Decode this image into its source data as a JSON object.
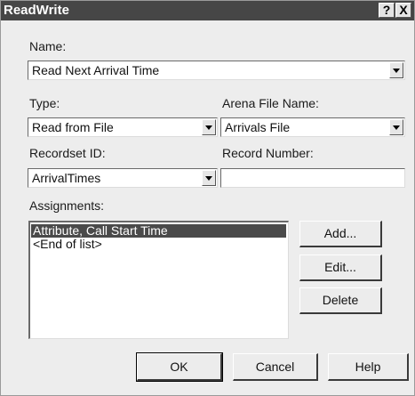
{
  "window": {
    "title": "ReadWrite",
    "help_glyph": "?",
    "close_glyph": "X"
  },
  "name": {
    "label": "Name:",
    "value": "Read Next Arrival Time"
  },
  "type": {
    "label": "Type:",
    "value": "Read from File"
  },
  "arena_file": {
    "label": "Arena File Name:",
    "value": "Arrivals File"
  },
  "recordset": {
    "label": "Recordset ID:",
    "value": "ArrivalTimes"
  },
  "record_number": {
    "label": "Record Number:",
    "value": ""
  },
  "assignments": {
    "label": "Assignments:",
    "items": [
      "Attribute, Call Start Time",
      "<End of list>"
    ],
    "selected_index": 0
  },
  "buttons": {
    "add": "Add...",
    "edit": "Edit...",
    "delete": "Delete",
    "ok": "OK",
    "cancel": "Cancel",
    "help": "Help"
  }
}
